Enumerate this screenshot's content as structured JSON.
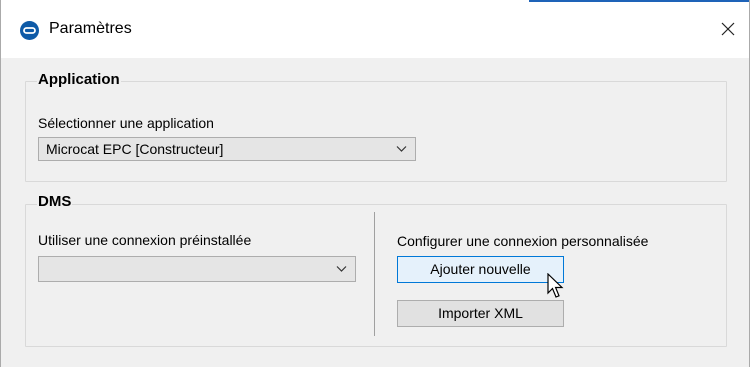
{
  "window": {
    "title": "Paramètres",
    "icon": "app-logo-icon",
    "close_icon": "close-icon",
    "accent_color": "#1e63b8"
  },
  "application_group": {
    "title": "Application",
    "select_label": "Sélectionner une application",
    "selected_value": "Microcat EPC [Constructeur]"
  },
  "dms_group": {
    "title": "DMS",
    "preinstalled_label": "Utiliser une connexion préinstallée",
    "preinstalled_value": "",
    "custom_label": "Configurer une connexion personnalisée",
    "add_button_label": "Ajouter nouvelle",
    "import_button_label": "Importer XML"
  }
}
